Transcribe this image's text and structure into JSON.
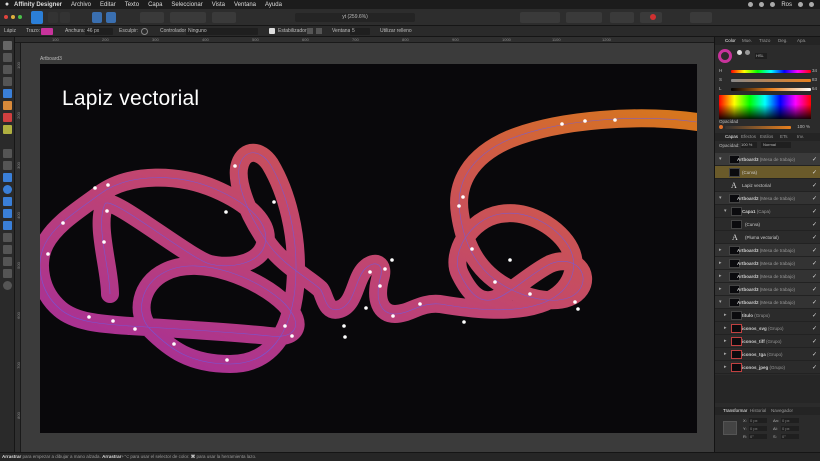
{
  "menubar": {
    "apple": "",
    "app": "Affinity Designer",
    "items": [
      "Archivo",
      "Editar",
      "Texto",
      "Capa",
      "Seleccionar",
      "Vista",
      "Ventana",
      "Ayuda"
    ],
    "user": "Ros"
  },
  "toolbar": {
    "doc_title": "yt (259.6%)"
  },
  "context": {
    "tool": "Lápiz",
    "stroke_label": "Trazo:",
    "width_label": "Anchura:",
    "width_value": "46 px",
    "sculpt_label": "Esculpir:",
    "controller_label": "Controlador:",
    "controller_value": "Ninguno",
    "stabilizer_label": "Estabilizador",
    "window_label": "Ventana:",
    "window_value": "5",
    "fill_label": "Utilizar relleno"
  },
  "ruler": {
    "ticks": [
      "100",
      "200",
      "300",
      "400",
      "500",
      "600",
      "700",
      "800",
      "900",
      "1000",
      "1100",
      "1200"
    ]
  },
  "vruler": {
    "ticks": [
      "100",
      "200",
      "300",
      "400",
      "500",
      "600",
      "700",
      "800"
    ]
  },
  "artboard": {
    "label": "Artboard3",
    "heading": "Lapiz vectorial"
  },
  "status": {
    "part1": "Arrastrar",
    "part2": " para empezar a dibujar a mano alzada. ",
    "part3": "Arrastrar",
    "part4": "+⌥ para usar el selector de color. ",
    "part5": "⌘",
    "part6": " para usar la herramienta lazo."
  },
  "color_panel": {
    "tabs": [
      "Color",
      "Mue.",
      "Trazo",
      "Deg.",
      "Apa."
    ],
    "mode": "HSL",
    "h_label": "H",
    "h_value": "34",
    "s_label": "S",
    "s_value": "83",
    "l_label": "L",
    "l_value": "64",
    "opacity_label": "Opacidad",
    "opacity_value": "100 %",
    "accent": "#e0702a"
  },
  "layers_panel": {
    "tabs": [
      "Capas",
      "Efectos",
      "Estilos",
      "ETs",
      "Inv."
    ],
    "opacity_label": "Opacidad:",
    "opacity_value": "100 %",
    "blend": "Normal",
    "rows": [
      {
        "name": "Artboard3",
        "type": "(Mesa de trabajo)"
      },
      {
        "name": "(Curva)",
        "type": ""
      },
      {
        "name": "Lapiz vectorial",
        "type": ""
      },
      {
        "name": "Artboard2",
        "type": "(Mesa de trabajo)"
      },
      {
        "name": "Capa1",
        "type": "(Capa)"
      },
      {
        "name": "(Curva)",
        "type": ""
      },
      {
        "name": "(Pluma vectorial)",
        "type": ""
      },
      {
        "name": "Artboard3",
        "type": "(Mesa de trabajo)"
      },
      {
        "name": "Artboard3",
        "type": "(Mesa de trabajo)"
      },
      {
        "name": "Artboard3",
        "type": "(Mesa de trabajo)"
      },
      {
        "name": "Artboard3",
        "type": "(Mesa de trabajo)"
      },
      {
        "name": "Artboard2",
        "type": "(Mesa de trabajo)"
      },
      {
        "name": "titulo",
        "type": "(Grupo)"
      },
      {
        "name": "iconos_svg",
        "type": "(Grupo)"
      },
      {
        "name": "iconos_tiff",
        "type": "(Grupo)"
      },
      {
        "name": "iconos_tga",
        "type": "(Grupo)"
      },
      {
        "name": "iconos_jpeg",
        "type": "(Grupo)"
      }
    ]
  },
  "transform_panel": {
    "tabs": [
      "Transformar",
      "Historial",
      "Navegador"
    ],
    "x_label": "X:",
    "x_value": "0 px",
    "y_label": "Y:",
    "y_value": "0 px",
    "w_label": "An:",
    "w_value": "0 px",
    "h_label": "Al:",
    "h_value": "0 px",
    "r_label": "R:",
    "r_value": "0°",
    "s_label": "S:",
    "s_value": "0°"
  }
}
